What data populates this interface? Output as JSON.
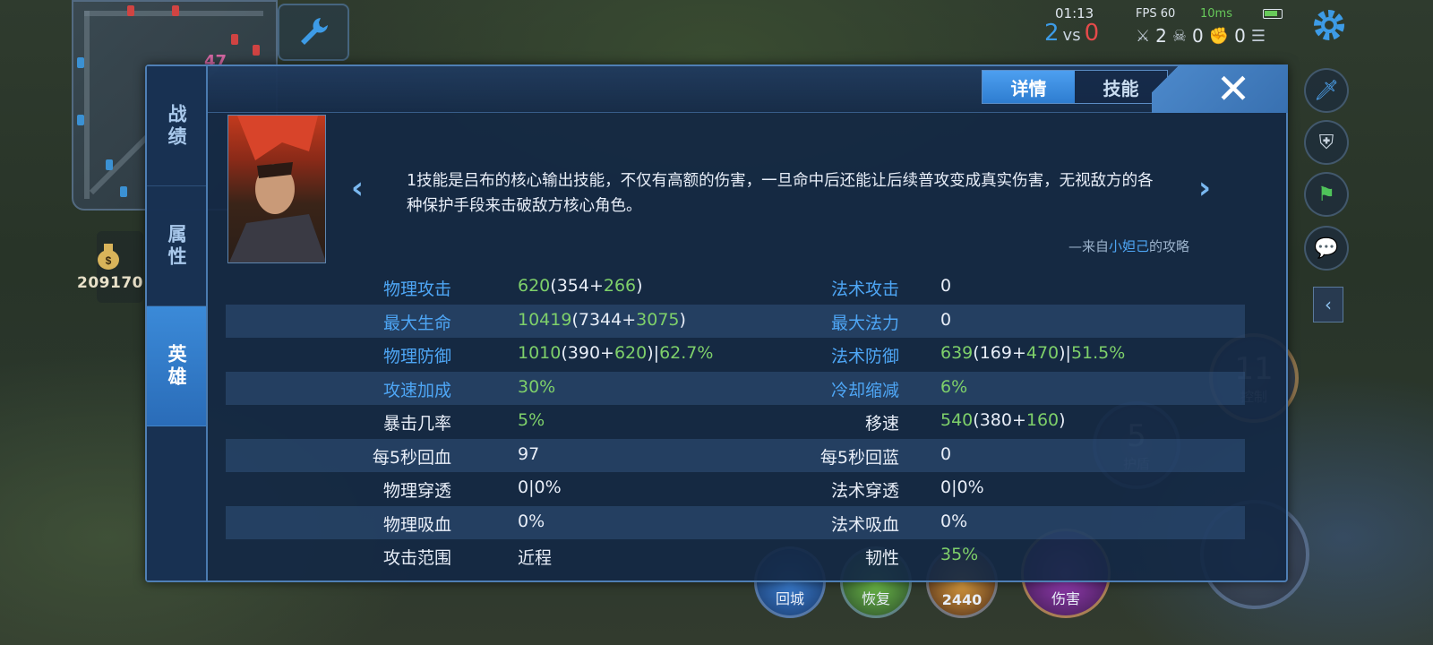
{
  "hud": {
    "time": "01:13",
    "score_blue": "2",
    "score_vs": "vs",
    "score_red": "0",
    "fps": "FPS 60",
    "ping": "10ms",
    "kills": "2",
    "deaths": "0",
    "assists": "0",
    "gold": "209170",
    "minimap_level": "47"
  },
  "background_skills": {
    "control_count": "11",
    "control_label": "控制",
    "shield_count": "5",
    "shield_label": "护盾",
    "recall": "回城",
    "heal": "恢复",
    "item_value": "2440",
    "damage": "伤害"
  },
  "panel": {
    "side_tabs": [
      "战绩",
      "属性",
      "英雄"
    ],
    "top_tabs": [
      "详情",
      "技能"
    ],
    "tip": "1技能是吕布的核心输出技能，不仅有高额的伤害，一旦命中后还能让后续普攻变成真实伤害，无视敌方的各种保护手段来击破敌方核心角色。",
    "source_prefix": "—来自",
    "source_author": "小妲己",
    "source_suffix": "的攻略"
  },
  "stats": [
    {
      "l_label": "物理攻击",
      "l_total": "620",
      "l_base": "354",
      "l_bonus": "266",
      "r_label": "法术攻击",
      "r_value": "0"
    },
    {
      "l_label": "最大生命",
      "l_total": "10419",
      "l_base": "7344",
      "l_bonus": "3075",
      "r_label": "最大法力",
      "r_value": "0"
    },
    {
      "l_label": "物理防御",
      "l_total": "1010",
      "l_base": "390",
      "l_bonus": "620",
      "l_pct": "62.7%",
      "r_label": "法术防御",
      "r_total": "639",
      "r_base": "169",
      "r_bonus": "470",
      "r_pct": "51.5%"
    },
    {
      "l_label": "攻速加成",
      "l_value": "30%",
      "r_label": "冷却缩减",
      "r_value": "6%"
    },
    {
      "l_label": "暴击几率",
      "l_value": "5%",
      "r_label": "移速",
      "r_total": "540",
      "r_base": "380",
      "r_bonus": "160"
    },
    {
      "l_label": "每5秒回血",
      "l_value": "97",
      "r_label": "每5秒回蓝",
      "r_value": "0"
    },
    {
      "l_label": "物理穿透",
      "l_value": "0|0%",
      "r_label": "法术穿透",
      "r_value": "0|0%"
    },
    {
      "l_label": "物理吸血",
      "l_value": "0%",
      "r_label": "法术吸血",
      "r_value": "0%"
    },
    {
      "l_label": "攻击范围",
      "l_value": "近程",
      "r_label": "韧性",
      "r_value": "35%"
    }
  ]
}
